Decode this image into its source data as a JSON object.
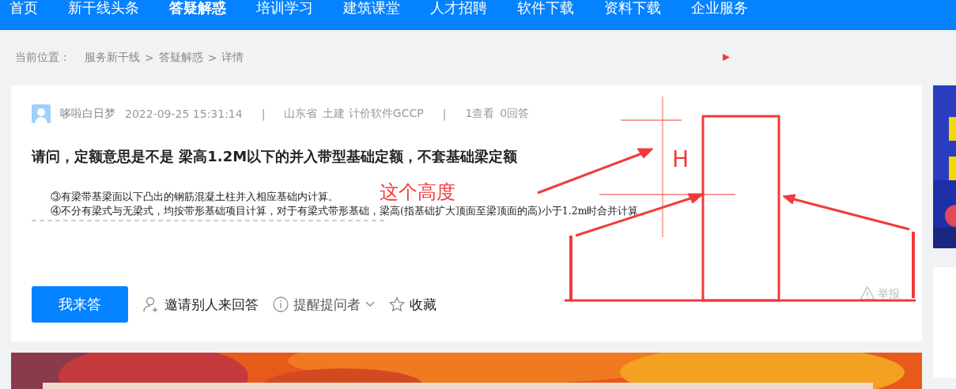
{
  "nav": [
    {
      "label": "首页",
      "selected": false
    },
    {
      "label": "新干线头条",
      "selected": false
    },
    {
      "label": "答疑解惑",
      "selected": true
    },
    {
      "label": "培训学习",
      "selected": false
    },
    {
      "label": "建筑课堂",
      "selected": false
    },
    {
      "label": "人才招聘",
      "selected": false
    },
    {
      "label": "软件下载",
      "selected": false
    },
    {
      "label": "资料下载",
      "selected": false
    },
    {
      "label": "企业服务",
      "selected": false
    }
  ],
  "breadcrumb": {
    "label": "当前位置：",
    "items": [
      "服务新干线",
      "答疑解惑",
      "详情"
    ],
    "separator": ">"
  },
  "question": {
    "author": "哆啦白日梦",
    "time": "2022-09-25 15:31:14",
    "region": "山东省",
    "tags": "土建 计价软件GCCP",
    "separator": "|",
    "views": "1查看",
    "answers": "0回答",
    "title": "请问，定额意思是不是 梁高1.2M以下的并入带型基础定额，不套基础梁定额",
    "image_lines": [
      "③有梁带基梁面以下凸出的钢筋混凝土柱并入相应基础内计算。",
      "④不分有梁式与无梁式，均按带形基础项目计算，对于有梁式带形基础，梁高(指基础扩大顶面至梁顶面的高)小于1.2m时合并计算，"
    ]
  },
  "actions": {
    "answer": "我来答",
    "invite": "邀请别人来回答",
    "remind": "提醒提问者",
    "favorite": "收藏",
    "report": "举报"
  },
  "annotation": {
    "labels": [
      "这个高度",
      "H"
    ]
  }
}
